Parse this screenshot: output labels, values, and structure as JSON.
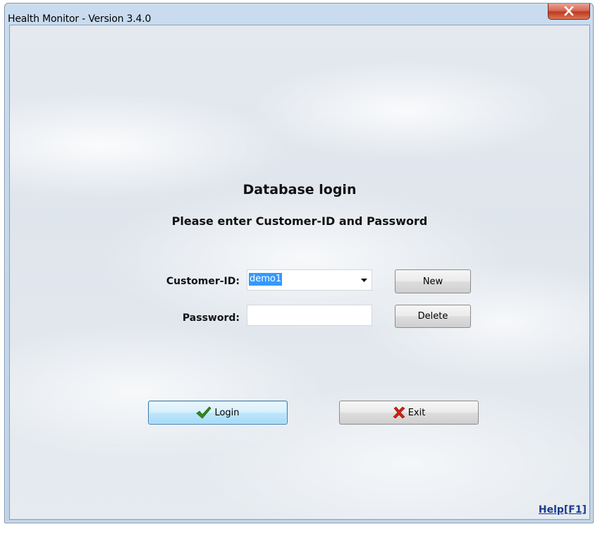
{
  "window": {
    "title": "Health Monitor - Version 3.4.0"
  },
  "main": {
    "heading": "Database login",
    "subheading": "Please enter Customer-ID and Password"
  },
  "form": {
    "customer_id_label": "Customer-ID:",
    "customer_id_value": "demo1",
    "password_label": "Password:",
    "password_value": ""
  },
  "buttons": {
    "new_label": "New",
    "delete_label": "Delete",
    "login_label": "Login",
    "exit_label": "Exit"
  },
  "help": {
    "label": "Help[F1]"
  },
  "icons": {
    "close": "close-icon",
    "dropdown": "chevron-down-icon",
    "login": "checkmark-icon",
    "exit": "x-icon"
  },
  "colors": {
    "close_button": "#c0391f",
    "login_check": "#2e8b1e",
    "exit_x": "#d0210f",
    "selection": "#3399ff",
    "help_link": "#1a3c8f"
  }
}
